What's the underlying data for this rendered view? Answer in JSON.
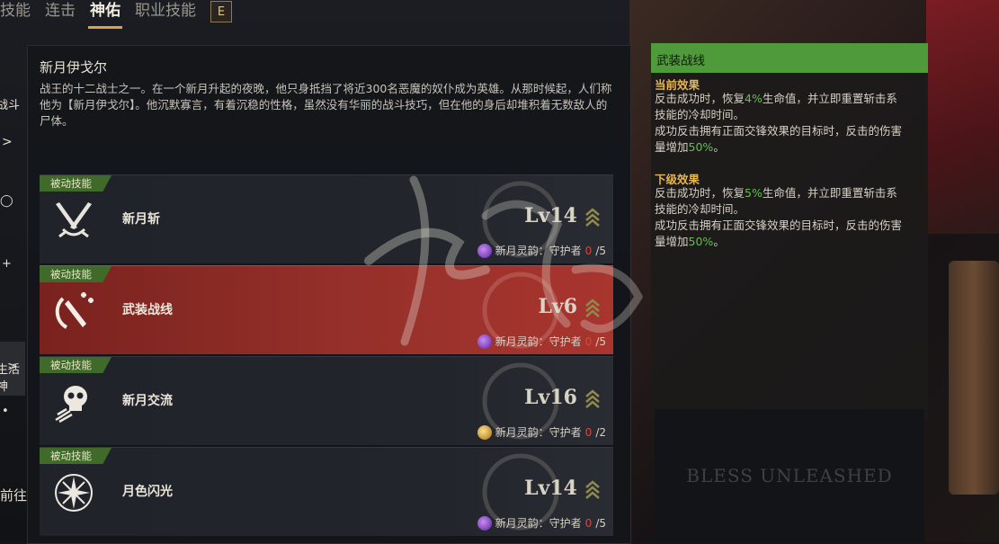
{
  "tabs": [
    {
      "label": "技能"
    },
    {
      "label": "连击"
    },
    {
      "label": "神佑",
      "active": true
    },
    {
      "label": "职业技能"
    }
  ],
  "tab_hotkey": "E",
  "sidebar": {
    "items": [
      "战斗",
      "生活神"
    ],
    "footer": "前往"
  },
  "god": {
    "name": "新月伊戈尔",
    "description": "战王的十二战士之一。在一个新月升起的夜晚，他只身抵挡了将近300名恶魔的奴仆成为英雄。从那时候起，人们称他为【新月伊戈尔】。他沉默寡言，有着沉稳的性格，虽然没有华丽的战斗技巧，但在他的身后却堆积着无数敌人的尸体。"
  },
  "skills": [
    {
      "tag": "被动技能",
      "name": "新月斩",
      "level": "Lv14",
      "spirit": "新月灵韵：守护者",
      "count_cur": "0",
      "count_max": "/5",
      "icon": "crossed-blades-icon",
      "spirit_color": "#8a3fd0"
    },
    {
      "tag": "被动技能",
      "name": "武装战线",
      "level": "Lv6",
      "spirit": "新月灵韵：守护者",
      "count_cur": "0",
      "count_max": "/5",
      "icon": "sword-slash-icon",
      "spirit_color": "#8a3fd0",
      "selected": true
    },
    {
      "tag": "被动技能",
      "name": "新月交流",
      "level": "Lv16",
      "spirit": "新月灵韵：守护者",
      "count_cur": "0",
      "count_max": "/2",
      "icon": "skull-icon",
      "spirit_color": "#d9a62a"
    },
    {
      "tag": "被动技能",
      "name": "月色闪光",
      "level": "Lv14",
      "spirit": "新月灵韵：守护者",
      "count_cur": "0",
      "count_max": "/5",
      "icon": "star-flash-icon",
      "spirit_color": "#8a3fd0"
    }
  ],
  "info": {
    "title": "武装战线",
    "current_title": "当前效果",
    "current_line1_a": "反击成功时，恢复",
    "current_line1_v": "4%",
    "current_line1_b": "生命值，并立即重置斩击系",
    "current_line2": "技能的冷却时间。",
    "current_line3": "成功反击拥有正面交锋效果的目标时，反击的伤害",
    "current_line4_a": "量增加",
    "current_line4_v": "50%",
    "current_line4_b": "。",
    "next_title": "下级效果",
    "next_line1_a": "反击成功时，恢复",
    "next_line1_v": "5%",
    "next_line1_b": "生命值，并立即重置斩击系",
    "next_line2": "技能的冷却时间。",
    "next_line3": "成功反击拥有正面交锋效果的目标时，反击的伤害",
    "next_line4_a": "量增加",
    "next_line4_v": "50%",
    "next_line4_b": "。"
  },
  "logo_text": "BLESS UNLEASHED",
  "colors": {
    "accent_gold": "#d9a441",
    "tag_green": "#3f6a2a",
    "header_green": "#4f9a3a",
    "selected_red": "#96302a",
    "value_green": "#5fc24a"
  }
}
